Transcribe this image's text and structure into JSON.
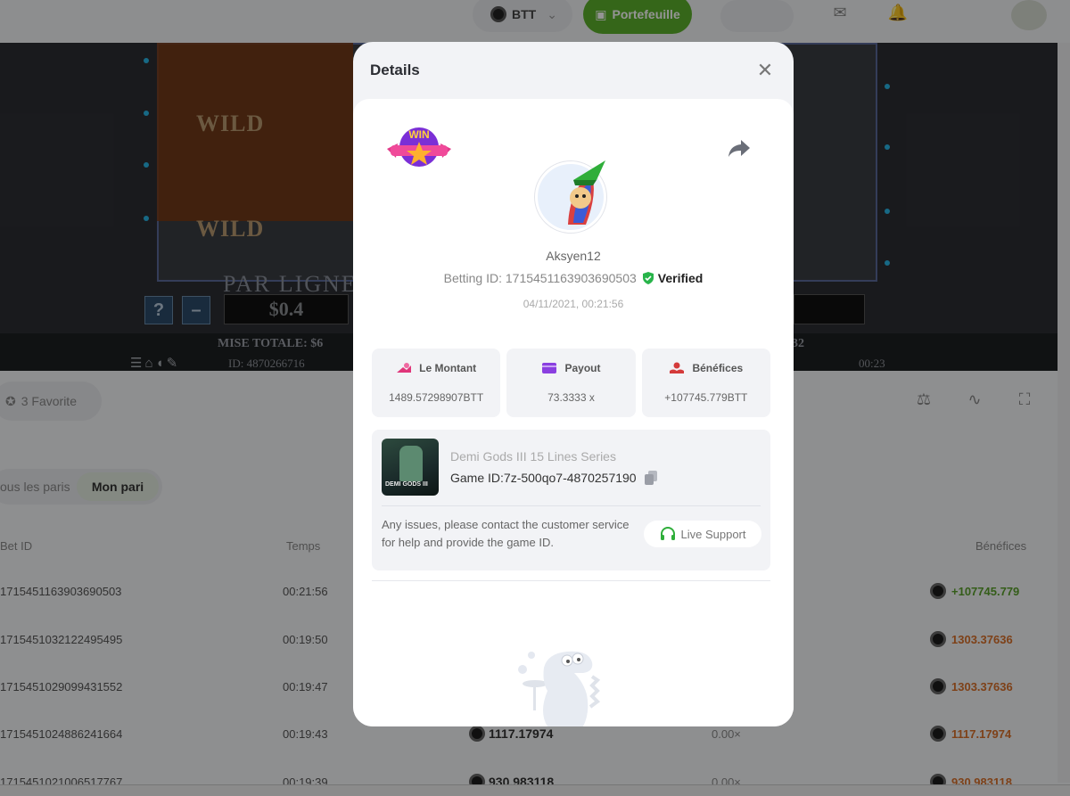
{
  "header": {
    "currency": "BTT",
    "wallet_label": "Portefeuille"
  },
  "game": {
    "wild_label": "WILD",
    "par_ligne": "PAR LIGNE",
    "bet_value": "$0.4",
    "help_symbol": "?",
    "minus_symbol": "–",
    "mise_totale": "MISE TOTALE: $6",
    "right_number": "32",
    "game_id": "ID: 4870266716",
    "time": "00:23"
  },
  "page": {
    "favorite_label": "3  Favorite",
    "tab_all": "ous les paris",
    "tab_mine": "Mon pari",
    "columns": {
      "bet_id": "Bet ID",
      "time": "Temps",
      "profit": "Bénéfices"
    },
    "rows": [
      {
        "bet_id": "1715451163903690503",
        "time": "00:21:56",
        "amount": "",
        "mult": "",
        "profit": "+107745.779",
        "color": "#5aa02c"
      },
      {
        "bet_id": "1715451032122495495",
        "time": "00:19:50",
        "amount": "",
        "mult": "",
        "profit": "1303.37636",
        "color": "#d9702a"
      },
      {
        "bet_id": "1715451029099431552",
        "time": "00:19:47",
        "amount": "",
        "mult": "",
        "profit": "1303.37636",
        "color": "#d9702a"
      },
      {
        "bet_id": "1715451024886241664",
        "time": "00:19:43",
        "amount": "1117.17974",
        "mult": "0.00×",
        "profit": "1117.17974",
        "color": "#d9702a"
      },
      {
        "bet_id": "1715451021006517767",
        "time": "00:19:39",
        "amount": "930.983118",
        "mult": "0.00×",
        "profit": "930.983118",
        "color": "#d9702a"
      }
    ]
  },
  "modal": {
    "title": "Details",
    "win_badge": "WIN",
    "username": "Aksyen12",
    "betting_id_label": "Betting ID: 1715451163903690503",
    "verified_label": "Verified",
    "date": "04/11/2021, 00:21:56",
    "stats": [
      {
        "label": "Le Montant",
        "value": "1489.57298907BTT",
        "color": "#e0367a"
      },
      {
        "label": "Payout",
        "value": "73.3333 x",
        "color": "#8a3fe0"
      },
      {
        "label": "Bénéfices",
        "value": "+107745.779BTT",
        "color": "#d43a3a"
      }
    ],
    "game_name": "Demi Gods III 15 Lines Series",
    "game_id": "Game ID:7z-500qo7-4870257190",
    "thumb_label": "DEMI GODS III",
    "help_text": "Any issues, please contact the customer service for help and provide the game ID.",
    "live_support": "Live Support"
  },
  "icons": {
    "close": "close-icon",
    "share": "share-icon",
    "copy": "copy-icon",
    "headset": "headset-icon",
    "verified": "shield-check-icon"
  }
}
